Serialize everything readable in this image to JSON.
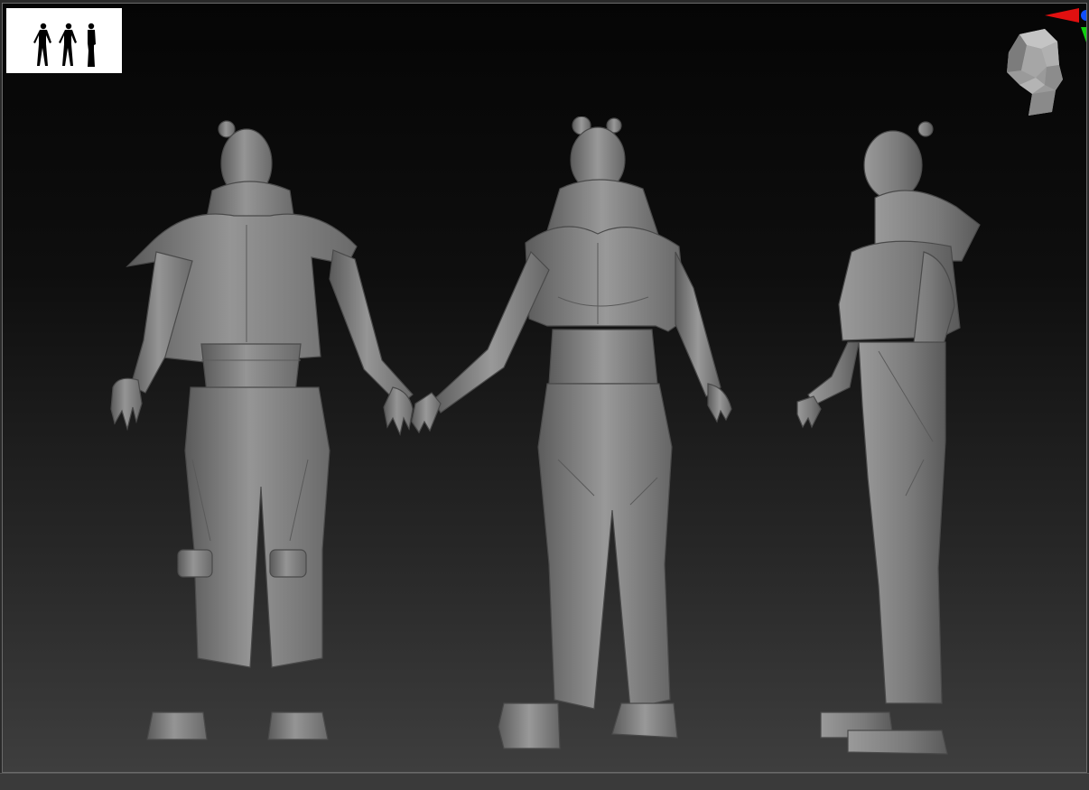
{
  "viewport": {
    "background_top": "#050505",
    "background_bottom": "#3e3e3e",
    "border_color": "#6a6a6a"
  },
  "thumbnail": {
    "icon": "three-figure-silhouette-icon",
    "background": "#ffffff",
    "silhouette_color": "#000000"
  },
  "navigation": {
    "icon": "head-orientation-icon",
    "color": "#b8b8b8"
  },
  "axis_gizmo": {
    "icon": "axis-gizmo-icon",
    "x_color": "#e01010",
    "y_color": "#10d010",
    "z_color": "#1050ff"
  },
  "model": {
    "material_color": "#8a8a8a",
    "views": [
      "front",
      "back",
      "side"
    ]
  }
}
